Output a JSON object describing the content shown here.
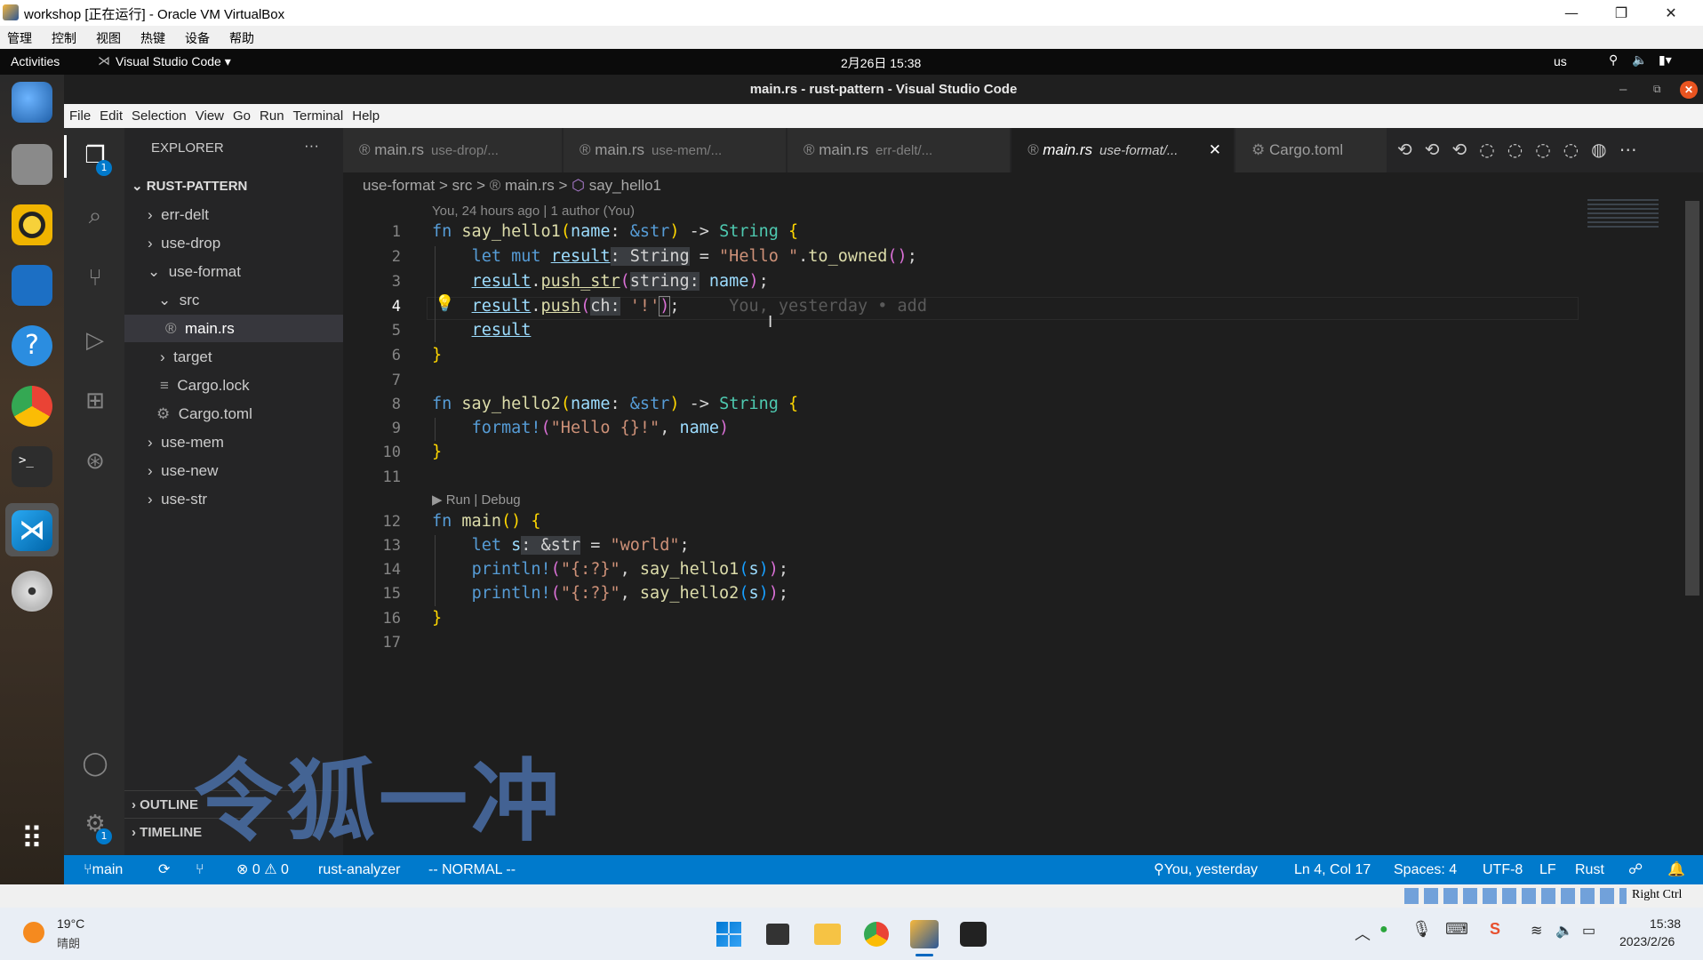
{
  "host_window": {
    "title": "workshop [正在运行] - Oracle VM VirtualBox",
    "menu": [
      "管理",
      "控制",
      "视图",
      "热键",
      "设备",
      "帮助"
    ],
    "controls": [
      "—",
      "❐",
      "✕"
    ]
  },
  "gnome": {
    "activities": "Activities",
    "app": "Visual Studio Code ▾",
    "clock": "2月26日 15:38",
    "keyboard": "us"
  },
  "vscode": {
    "title": "main.rs - rust-pattern - Visual Studio Code",
    "menu": [
      "File",
      "Edit",
      "Selection",
      "View",
      "Go",
      "Run",
      "Terminal",
      "Help"
    ],
    "explorer": {
      "header": "EXPLORER",
      "more": "···",
      "root": "RUST-PATTERN",
      "badge": "1",
      "items": [
        {
          "label": "err-delt",
          "chev": "›"
        },
        {
          "label": "use-drop",
          "chev": "›"
        },
        {
          "label": "use-format",
          "chev": "⌄"
        },
        {
          "label": "src",
          "chev": "⌄"
        },
        {
          "label": "main.rs",
          "icon": "®"
        },
        {
          "label": "target",
          "chev": "›"
        },
        {
          "label": "Cargo.lock",
          "icon": "≡"
        },
        {
          "label": "Cargo.toml",
          "icon": "⚙"
        },
        {
          "label": "use-mem",
          "chev": "›"
        },
        {
          "label": "use-new",
          "chev": "›"
        },
        {
          "label": "use-str",
          "chev": "›"
        }
      ],
      "outline": "OUTLINE",
      "timeline": "TIMELINE"
    },
    "tabs": [
      {
        "name": "main.rs",
        "path": "use-drop/..."
      },
      {
        "name": "main.rs",
        "path": "use-mem/..."
      },
      {
        "name": "main.rs",
        "path": "err-delt/..."
      },
      {
        "name": "main.rs",
        "path": "use-format/..."
      },
      {
        "name": "Cargo.toml",
        "path": ""
      }
    ],
    "breadcrumb": [
      "use-format",
      ">",
      "src",
      ">",
      "main.rs",
      ">",
      "say_hello1"
    ],
    "blame": "You, 24 hours ago | 1 author (You)",
    "inline_blame": "You, yesterday • add",
    "codelens": "▶ Run | Debug",
    "line_numbers": [
      "1",
      "2",
      "3",
      "4",
      "5",
      "6",
      "7",
      "8",
      "9",
      "10",
      "11",
      "12",
      "13",
      "14",
      "15",
      "16",
      "17"
    ],
    "status": {
      "branch": "main",
      "errors": "⊗ 0 ⚠ 0",
      "server": "rust-analyzer",
      "mode": "-- NORMAL --",
      "author": "You, yesterday",
      "position": "Ln 4, Col 17",
      "spaces": "Spaces: 4",
      "encoding": "UTF-8",
      "eol": "LF",
      "language": "Rust"
    }
  },
  "watermark": "令狐一冲",
  "vbox_status": {
    "hostkey": "Right Ctrl"
  },
  "taskbar": {
    "weather_temp": "19°C",
    "weather_desc": "晴朗",
    "time": "15:38",
    "date": "2023/2/26"
  }
}
